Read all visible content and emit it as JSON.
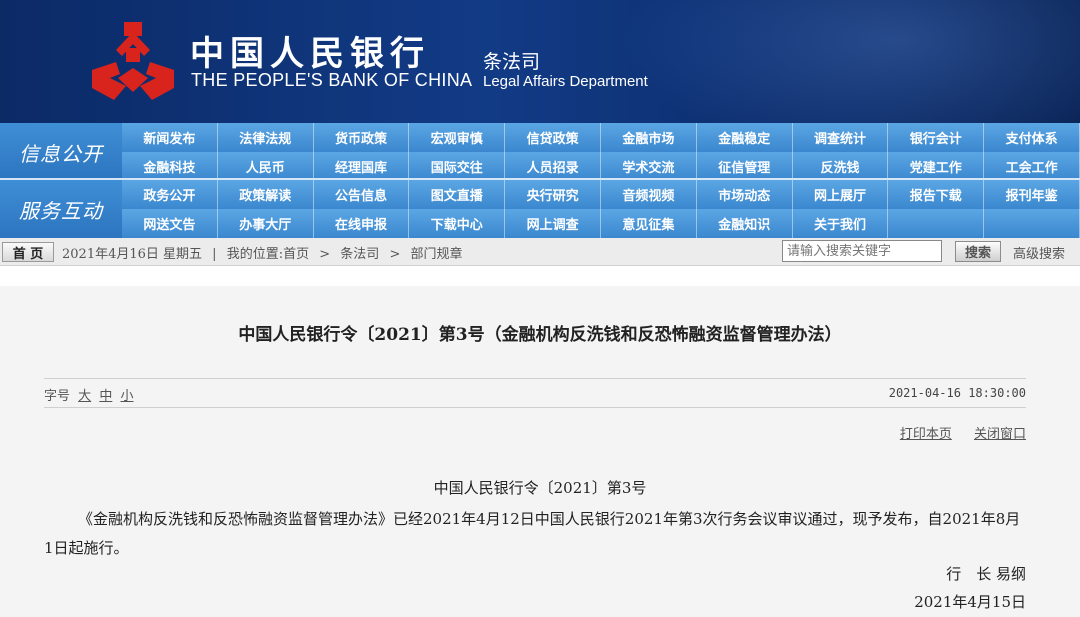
{
  "header": {
    "bank_cn": "中国人民银行",
    "bank_en": "THE PEOPLE'S BANK OF CHINA",
    "dept_cn": "条法司",
    "dept_en": "Legal Affairs Department"
  },
  "nav1": {
    "label": "信息公开",
    "items": [
      "新闻发布",
      "法律法规",
      "货币政策",
      "宏观审慎",
      "信贷政策",
      "金融市场",
      "金融稳定",
      "调查统计",
      "银行会计",
      "支付体系",
      "金融科技",
      "人民币",
      "经理国库",
      "国际交往",
      "人员招录",
      "学术交流",
      "征信管理",
      "反洗钱",
      "党建工作",
      "工会工作"
    ]
  },
  "nav2": {
    "label": "服务互动",
    "items": [
      "政务公开",
      "政策解读",
      "公告信息",
      "图文直播",
      "央行研究",
      "音频视频",
      "市场动态",
      "网上展厅",
      "报告下载",
      "报刊年鉴",
      "网送文告",
      "办事大厅",
      "在线申报",
      "下载中心",
      "网上调查",
      "意见征集",
      "金融知识",
      "关于我们",
      "",
      ""
    ]
  },
  "breadcrumb": {
    "home": "首 页",
    "date": "2021年4月16日  星期五",
    "sep": "|",
    "location_label": "我的位置:首页",
    "arrow1": ">",
    "crumb1": "条法司",
    "arrow2": ">",
    "crumb2": "部门规章"
  },
  "search": {
    "placeholder": "请输入搜索关键字",
    "button": "搜索",
    "advanced": "高级搜索"
  },
  "article": {
    "title": "中国人民银行令〔2021〕第3号（金融机构反洗钱和反恐怖融资监督管理办法）",
    "fontsize_label": "字号",
    "font_large": "大",
    "font_medium": "中",
    "font_small": "小",
    "datetime": "2021-04-16 18:30:00",
    "print": "打印本页",
    "close": "关闭窗口",
    "order_title": "中国人民银行令〔2021〕第3号",
    "paragraph": "《金融机构反洗钱和反恐怖融资监督管理办法》已经2021年4月12日中国人民银行2021年第3次行务会议审议通过，现予发布，自2021年8月1日起施行。",
    "signature": "行　长  易纲",
    "sign_date": "2021年4月15日"
  },
  "colors": {
    "header_bg": "#123b86",
    "nav_blue": "#3b87cf",
    "logo_red": "#d8241c"
  }
}
